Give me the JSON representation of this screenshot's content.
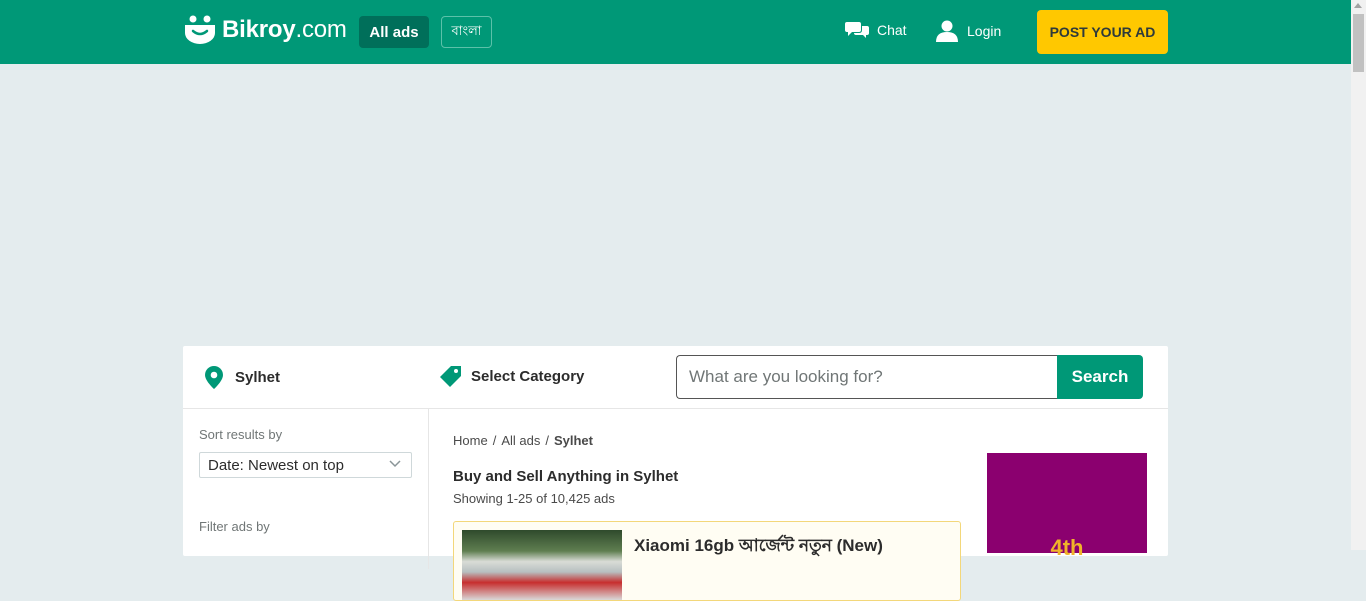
{
  "header": {
    "logo_text": "Bikroy",
    "logo_suffix": ".com",
    "all_ads_label": "All ads",
    "language_label": "বাংলা",
    "chat_label": "Chat",
    "login_label": "Login",
    "post_ad_label": "POST YOUR AD",
    "colors": {
      "brand": "#009877",
      "post_button": "#ffc800"
    }
  },
  "search": {
    "location": "Sylhet",
    "category": "Select Category",
    "placeholder": "What are you looking for?",
    "button_label": "Search"
  },
  "sidebar": {
    "sort_label": "Sort results by",
    "sort_value": "Date: Newest on top",
    "filter_label": "Filter ads by"
  },
  "main": {
    "breadcrumbs": [
      "Home",
      "All ads",
      "Sylhet"
    ],
    "heading": "Buy and Sell Anything in Sylhet",
    "results_count": "Showing 1-25 of 10,425 ads",
    "ads": [
      {
        "title": "Xiaomi 16gb আর্জেন্ট নতুন (New)"
      }
    ]
  },
  "banner": {
    "text": "4th",
    "color": "#8b006f"
  }
}
